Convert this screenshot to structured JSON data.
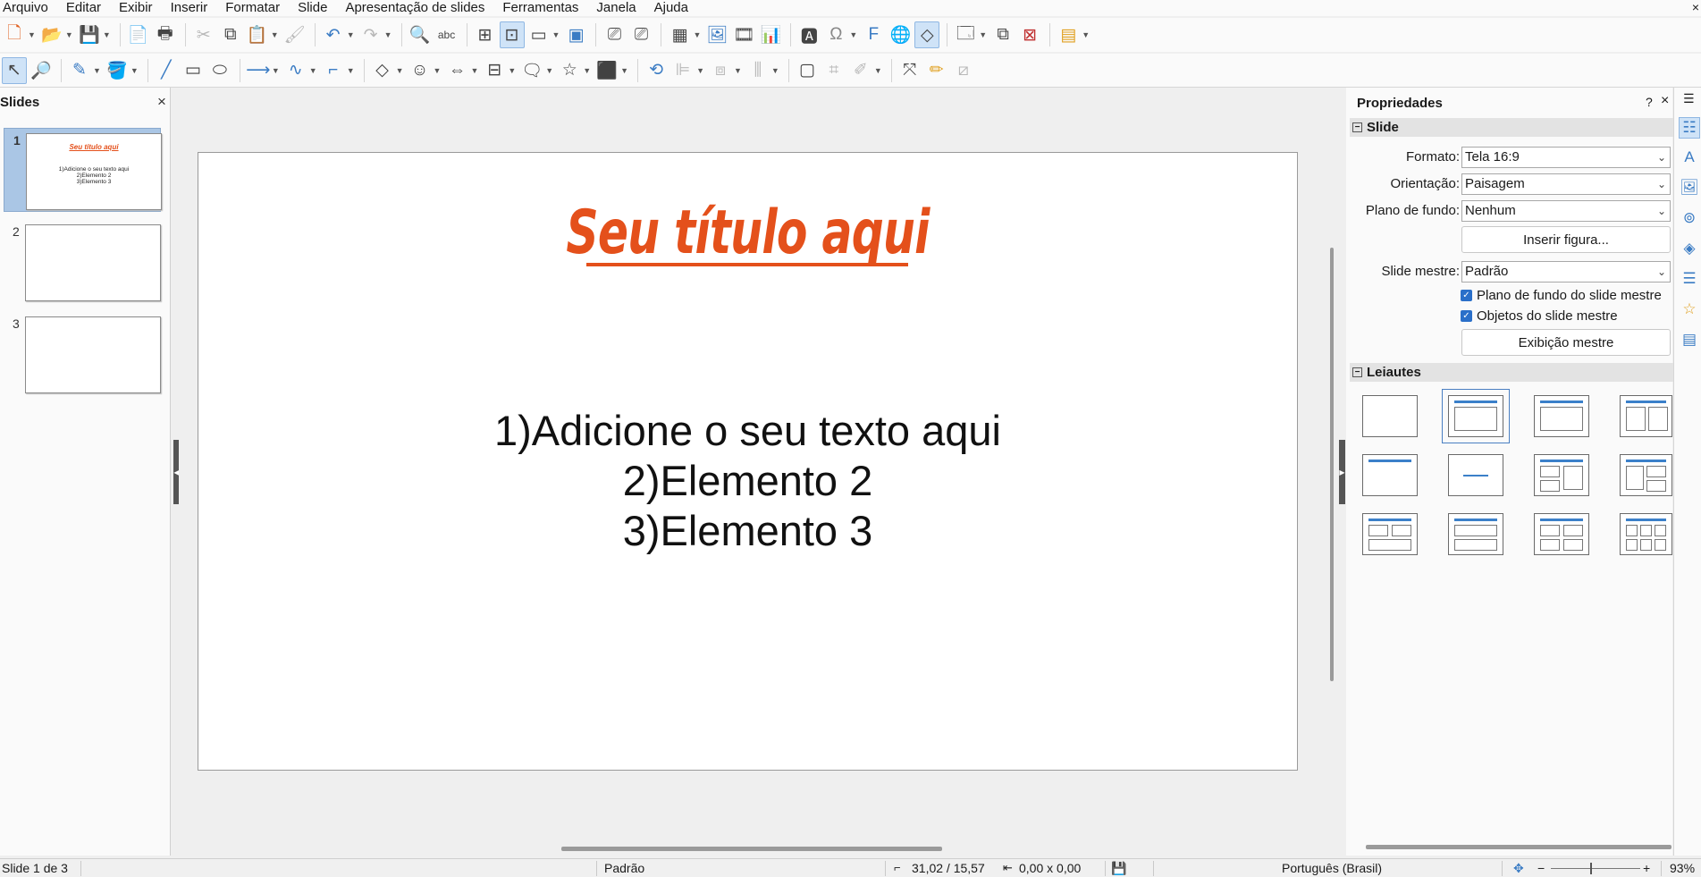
{
  "menubar": {
    "items": [
      "Arquivo",
      "Editar",
      "Exibir",
      "Inserir",
      "Formatar",
      "Slide",
      "Apresentação de slides",
      "Ferramentas",
      "Janela",
      "Ajuda"
    ],
    "close_glyph": "×"
  },
  "toolbar1": {
    "icons": [
      "new-doc-icon",
      "open-icon",
      "save-icon",
      "export-pdf-icon",
      "print-icon",
      "cut-icon",
      "copy-icon",
      "paste-icon",
      "clone-format-icon",
      "undo-icon",
      "redo-icon",
      "find-replace-icon",
      "spelling-icon",
      "grid-icon",
      "helplines-icon",
      "display-views-icon",
      "master-slide-icon",
      "start-first-icon",
      "start-current-icon",
      "table-icon",
      "image-icon",
      "media-icon",
      "chart-icon",
      "textbox-icon",
      "special-char-icon",
      "fontwork-icon",
      "hyperlink-icon",
      "shapes-icon",
      "new-slide-icon",
      "duplicate-slide-icon",
      "delete-slide-icon",
      "slide-layout-icon"
    ]
  },
  "toolbar2": {
    "icons": [
      "select-icon",
      "zoom-icon",
      "line-color-icon",
      "fill-color-icon",
      "line-icon",
      "rectangle-icon",
      "ellipse-icon",
      "arrow-icon",
      "curve-icon",
      "connector-icon",
      "basic-shapes-icon",
      "symbol-shapes-icon",
      "block-arrows-icon",
      "flowchart-icon",
      "callouts-icon",
      "stars-icon",
      "3d-objects-icon",
      "transform-icon",
      "align-icon",
      "arrange-icon",
      "distribute-icon",
      "shadow-icon",
      "crop-icon",
      "filter-icon",
      "points-icon",
      "glue-icon",
      "toggle-extrusion-icon"
    ]
  },
  "slides_panel": {
    "title": "Slides",
    "close_glyph": "×",
    "slides": [
      {
        "number": "1",
        "title": "Seu título aqui",
        "body": [
          "1)Adicione o seu texto aqui",
          "2)Elemento 2",
          "3)Elemento 3"
        ]
      },
      {
        "number": "2"
      },
      {
        "number": "3"
      }
    ]
  },
  "slide": {
    "title": "Seu título aqui",
    "body": [
      "1)Adicione o seu texto aqui",
      "2)Elemento 2",
      "3)Elemento 3"
    ],
    "title_color": "#e4501b"
  },
  "sidebar": {
    "title": "Propriedades",
    "help": "?",
    "close": "×",
    "section_slide": "Slide",
    "labels": {
      "format": "Formato:",
      "orientation": "Orientação:",
      "background": "Plano de fundo:",
      "master": "Slide mestre:"
    },
    "values": {
      "format": "Tela 16:9",
      "orientation": "Paisagem",
      "background": "Nenhum",
      "master": "Padrão"
    },
    "insert_image": "Inserir figura...",
    "check_master_bg": "Plano de fundo do slide mestre",
    "check_master_objects": "Objetos do slide mestre",
    "master_view": "Exibição mestre",
    "section_layouts": "Leiautes"
  },
  "statusbar": {
    "slide_info": "Slide 1 de 3",
    "master": "Padrão",
    "position": "31,02 / 15,57",
    "size": "0,00 x 0,00",
    "language": "Português (Brasil)",
    "zoom": "93%"
  },
  "colors": {
    "accent": "#3b80c9",
    "title": "#e4501b",
    "selection": "#aac6e5"
  }
}
